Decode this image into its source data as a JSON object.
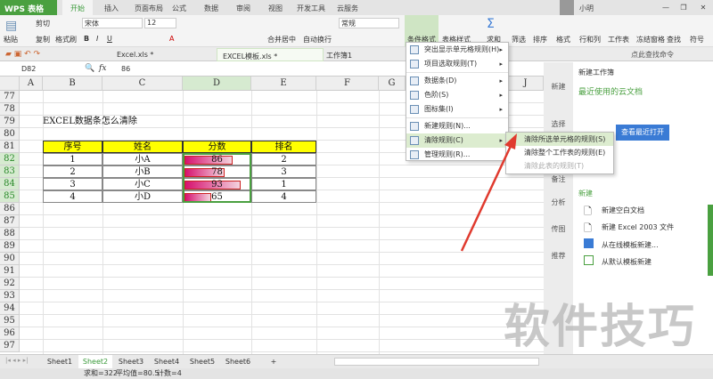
{
  "app": {
    "logo": "WPS 表格",
    "user": "小明"
  },
  "tabs": [
    "开始",
    "插入",
    "页面布局",
    "公式",
    "数据",
    "审阅",
    "视图",
    "开发工具",
    "云服务"
  ],
  "ribbon": {
    "paste": "粘贴",
    "cut": "剪切",
    "copy": "复制",
    "format_painter": "格式刷",
    "font": "宋体",
    "size": "12",
    "merge": "合并居中",
    "wrap": "自动换行",
    "number_format": "常规",
    "cond_format": "条件格式",
    "table_style": "表格样式",
    "sum": "求和",
    "filter": "筛选",
    "sort": "排序",
    "format": "格式",
    "rowcol": "行和列",
    "sheet": "工作表",
    "freeze": "冻结窗格",
    "find": "查找",
    "symbol": "符号",
    "search_cmd": "点此查找命令"
  },
  "doc_tabs": [
    "Excel.xls *",
    "EXCEL模板.xls *",
    "工作簿1"
  ],
  "formula": {
    "cell_ref": "D82",
    "fx": "fx",
    "value": "86"
  },
  "columns": [
    "A",
    "B",
    "C",
    "D",
    "E",
    "F",
    "G",
    "J"
  ],
  "rows": [
    "77",
    "78",
    "79",
    "80",
    "81",
    "82",
    "83",
    "84",
    "85",
    "86",
    "87",
    "88",
    "89",
    "90",
    "91",
    "92",
    "93",
    "94",
    "95",
    "96",
    "97"
  ],
  "sheet": {
    "title": "EXCEL数据条怎么清除",
    "headers": [
      "序号",
      "姓名",
      "分数",
      "排名"
    ],
    "data": [
      [
        "1",
        "小A",
        "86",
        "2"
      ],
      [
        "2",
        "小B",
        "78",
        "3"
      ],
      [
        "3",
        "小C",
        "93",
        "1"
      ],
      [
        "4",
        "小D",
        "65",
        "4"
      ]
    ]
  },
  "menu": [
    "突出显示单元格规则(H)",
    "项目选取规则(T)",
    "数据条(D)",
    "色阶(S)",
    "图标集(I)",
    "新建规则(N)...",
    "清除规则(C)",
    "管理规则(R)..."
  ],
  "submenu": [
    "清除所选单元格的规则(S)",
    "清除整个工作表的规则(E)",
    "清除此表的规则(T)"
  ],
  "pane": {
    "title": "新建工作簿",
    "cloud": "最近使用的云文档",
    "view_recent": "查看最近打开",
    "new_head": "新建",
    "items": [
      "新建空白文档",
      "新建 Excel 2003 文件",
      "从在线模板新建...",
      "从默认模板新建"
    ],
    "strip": [
      "新建",
      "选择",
      "备注",
      "分析",
      "传图",
      "推荐"
    ]
  },
  "sheet_tabs": [
    "Sheet1",
    "Sheet2",
    "Sheet3",
    "Sheet4",
    "Sheet5",
    "Sheet6",
    "+"
  ],
  "status": {
    "sum": "求和=322",
    "avg": "平均值=80.5",
    "count": "计数=4"
  },
  "watermark": "软件技巧",
  "colors": {
    "accent": "#4aa040",
    "bar": "#d6116f",
    "header_fill": "#ffff00"
  }
}
